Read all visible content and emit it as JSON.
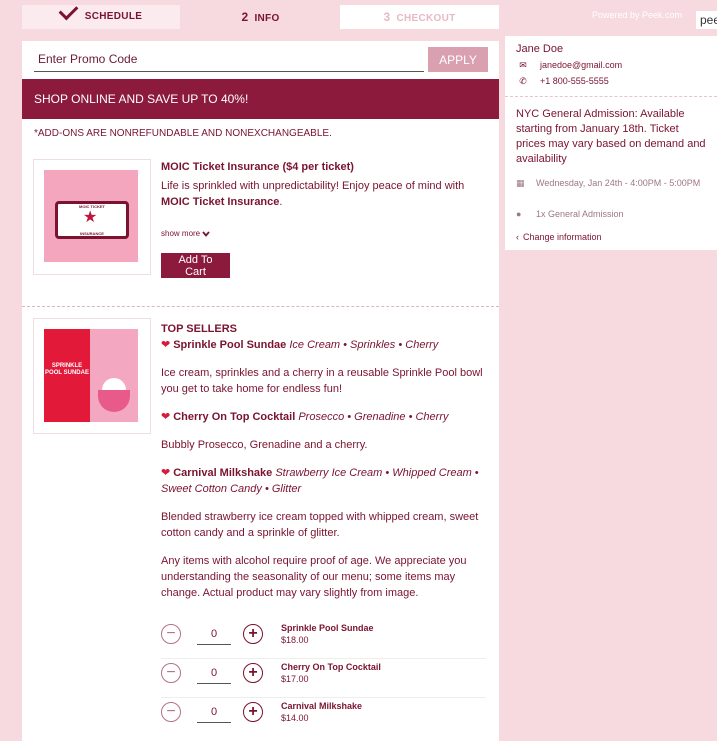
{
  "steps": [
    {
      "label": "SCHEDULE",
      "num": ""
    },
    {
      "label": "INFO",
      "num": "2"
    },
    {
      "label": "CHECKOUT",
      "num": "3"
    }
  ],
  "powered_by": "Powered by Peek.com",
  "logo_text": "peek",
  "promo": {
    "placeholder": "Enter Promo Code",
    "apply_label": "APPLY"
  },
  "banner": "SHOP ONLINE AND SAVE UP TO 40%!",
  "notice": "*ADD-ONS ARE NONREFUNDABLE AND NONEXCHANGEABLE.",
  "insurance": {
    "image_line1": "MOIC TICKET",
    "image_line2": "INSURANCE",
    "title": "MOIC Ticket Insurance ($4 per ticket)",
    "desc_prefix": "Life is sprinkled with unpredictability! Enjoy peace of mind with ",
    "desc_bold": "MOIC Ticket Insurance",
    "desc_suffix": ".",
    "show_more": "show more",
    "add_to_cart": "Add To Cart"
  },
  "top_sellers": {
    "image_text": "SPRINKLE POOL SUNDAE",
    "heading": "TOP SELLERS",
    "items": [
      {
        "title": "Sprinkle Pool Sundae",
        "tags": "Ice Cream • Sprinkles • Cherry",
        "desc": "Ice cream, sprinkles and a cherry in a reusable Sprinkle Pool bowl you get to take home for endless fun!"
      },
      {
        "title": "Cherry On Top Cocktail",
        "tags": "Prosecco • Grenadine • Cherry",
        "desc": "Bubbly Prosecco, Grenadine and a cherry."
      },
      {
        "title": "Carnival Milkshake",
        "tags": "Strawberry Ice Cream • Whipped Cream • Sweet Cotton Candy • Glitter",
        "desc": "Blended strawberry ice cream topped with whipped cream, sweet cotton candy and a sprinkle of glitter."
      }
    ],
    "disclaimer": "Any items with alcohol require proof of age. We appreciate you understanding the seasonality of our menu; some items may change. Actual product may vary slightly from image."
  },
  "quantities": [
    {
      "name": "Sprinkle Pool Sundae",
      "price": "$18.00",
      "qty": "0"
    },
    {
      "name": "Cherry On Top Cocktail",
      "price": "$17.00",
      "qty": "0"
    },
    {
      "name": "Carnival Milkshake",
      "price": "$14.00",
      "qty": "0"
    }
  ],
  "sidebar": {
    "name": "Jane Doe",
    "email": "janedoe@gmail.com",
    "phone": "+1 800-555-5555",
    "availability": "NYC General Admission: Available starting from January 18th. Ticket prices may vary based on demand and availability",
    "date": "Wednesday, Jan 24th - 4:00PM - 5:00PM",
    "tickets": "1x General Admission",
    "change_link": "Change information"
  },
  "colors": {
    "brand": "#8b1a3c",
    "page_bg": "#f7d9e0",
    "heart": "#d81b3a"
  }
}
